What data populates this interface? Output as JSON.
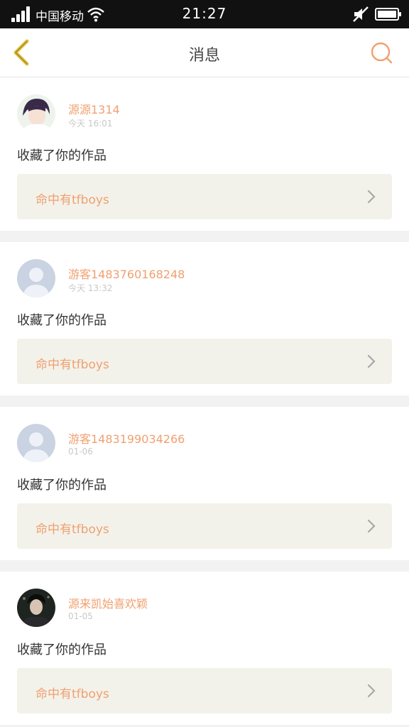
{
  "status_bar": {
    "carrier": "中国移动",
    "time": "21:27"
  },
  "nav": {
    "title": "消息",
    "back_icon": "chevron-left-icon",
    "search_icon": "search-icon"
  },
  "colors": {
    "accent": "#f0a070",
    "back_accent": "#e2c23a",
    "card_box": "#f3f2ea"
  },
  "messages": [
    {
      "username": "源源1314",
      "time": "今天 16:01",
      "action": "收藏了你的作品",
      "work_title": "命中有tfboys",
      "avatar": "photo-avatar-girl"
    },
    {
      "username": "游客1483760168248",
      "time": "今天 13:32",
      "action": "收藏了你的作品",
      "work_title": "命中有tfboys",
      "avatar": "default-avatar"
    },
    {
      "username": "游客1483199034266",
      "time": "01-06",
      "action": "收藏了你的作品",
      "work_title": "命中有tfboys",
      "avatar": "default-avatar"
    },
    {
      "username": "源来凯始喜欢颖",
      "time": "01-05",
      "action": "收藏了你的作品",
      "work_title": "命中有tfboys",
      "avatar": "photo-avatar-dark"
    }
  ]
}
